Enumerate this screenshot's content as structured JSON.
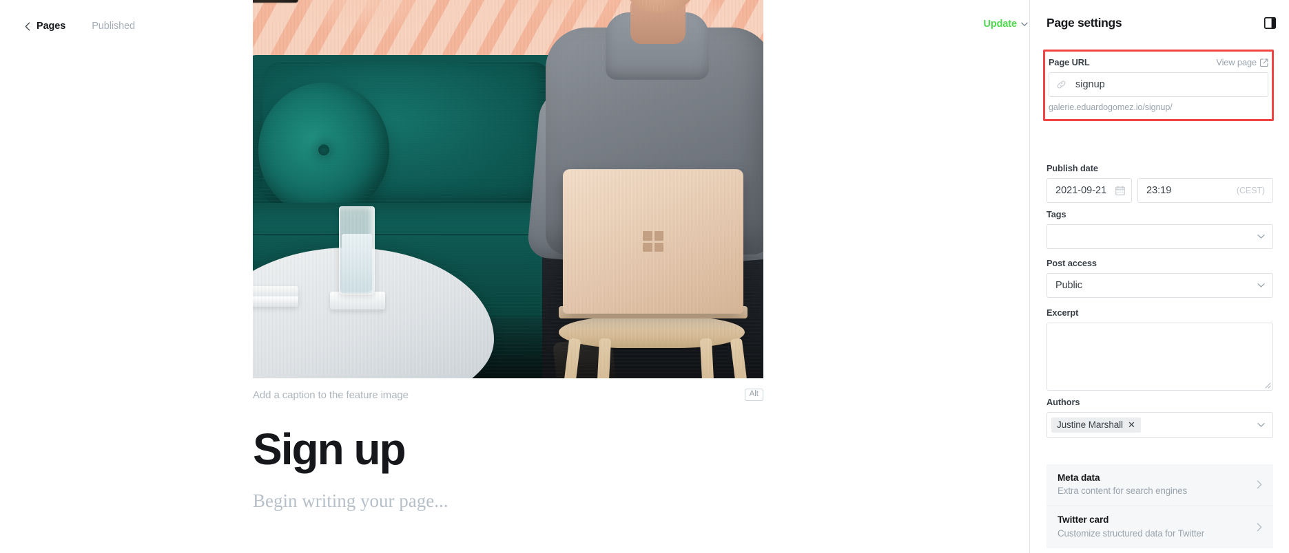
{
  "topbar": {
    "back_label": "Pages",
    "status_label": "Published",
    "update_label": "Update"
  },
  "editor": {
    "caption_placeholder": "Add a caption to the feature image",
    "alt_badge": "Alt",
    "title": "Sign up",
    "body_placeholder": "Begin writing your page..."
  },
  "sidebar": {
    "title": "Page settings",
    "page_url": {
      "label": "Page URL",
      "view_page_label": "View page",
      "value": "signup",
      "preview": "galerie.eduardogomez.io/signup/",
      "highlight_color": "#f04542"
    },
    "publish_date": {
      "label": "Publish date",
      "date_value": "2021-09-21",
      "time_value": "23:19",
      "timezone": "(CEST)"
    },
    "tags": {
      "label": "Tags",
      "value": "",
      "placeholder": ""
    },
    "post_access": {
      "label": "Post access",
      "value": "Public"
    },
    "excerpt": {
      "label": "Excerpt",
      "value": ""
    },
    "authors": {
      "label": "Authors",
      "tokens": [
        {
          "name": "Justine Marshall",
          "remove": "✕"
        }
      ]
    },
    "panels": [
      {
        "title": "Meta data",
        "subtitle": "Extra content for search engines"
      },
      {
        "title": "Twitter card",
        "subtitle": "Customize structured data for Twitter"
      }
    ]
  },
  "colors": {
    "accent_green": "#4fd94f",
    "highlight_red": "#f04542",
    "text_primary": "#15171a",
    "text_muted": "#9aa4ae"
  }
}
